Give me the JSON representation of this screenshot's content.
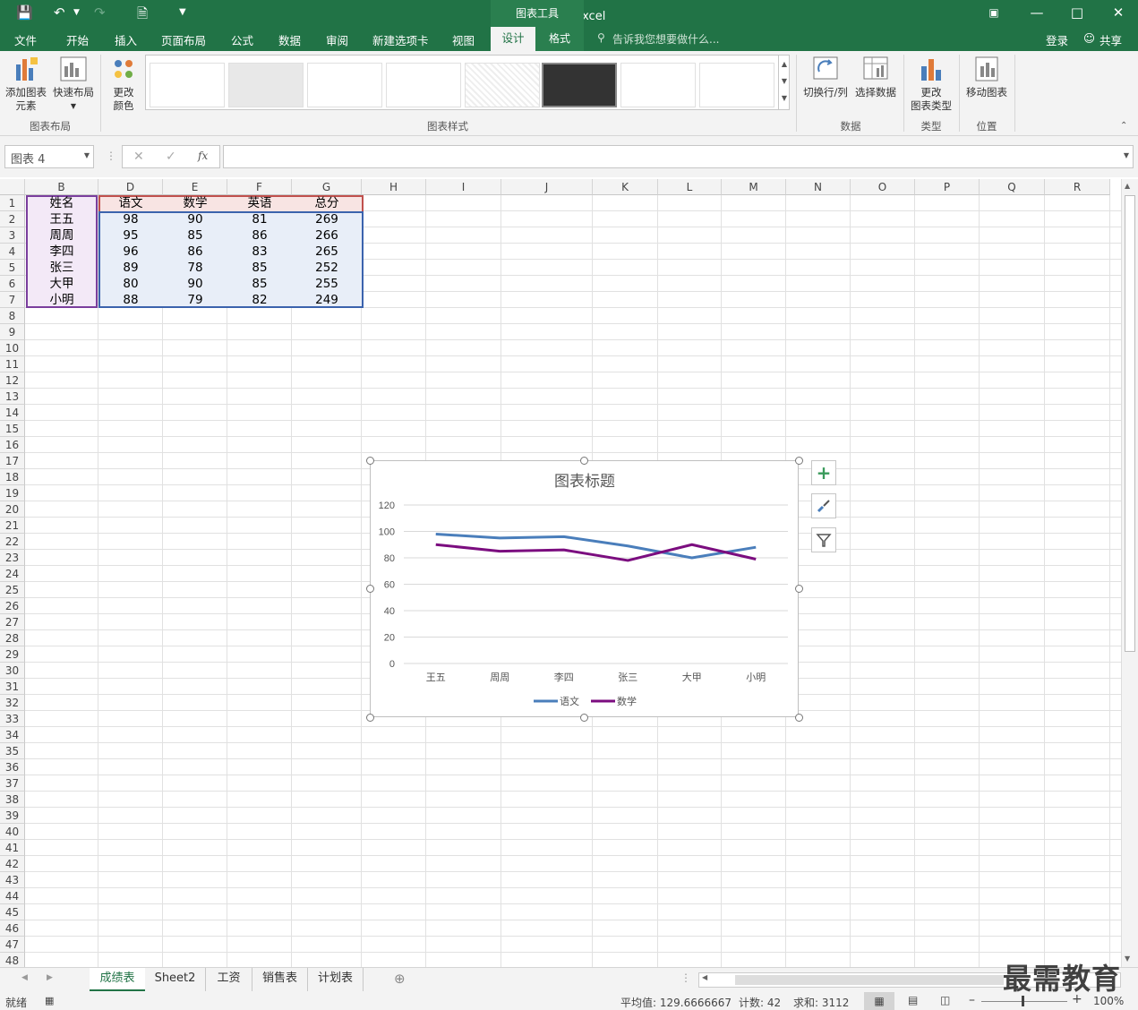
{
  "window": {
    "title": "表格1 - Excel",
    "context_tool": "图表工具"
  },
  "tabs": [
    "文件",
    "开始",
    "插入",
    "页面布局",
    "公式",
    "数据",
    "审阅",
    "新建选项卡",
    "视图"
  ],
  "active_tab": "设计",
  "format_tab": "格式",
  "tell_me": "告诉我您想要做什么...",
  "login": "登录",
  "share": "共享",
  "ribbon": {
    "add_element": "添加图表",
    "add_element2": "元素",
    "quick_layout": "快速布局",
    "change_color": "更改",
    "change_color2": "颜色",
    "group_layout": "图表布局",
    "group_styles": "图表样式",
    "switch_rowcol": "切换行/列",
    "select_data": "选择数据",
    "group_data": "数据",
    "change_type": "更改",
    "change_type2": "图表类型",
    "group_type": "类型",
    "move_chart": "移动图表",
    "group_location": "位置"
  },
  "namebox": "图表 4",
  "fx": "fx",
  "columns": [
    "B",
    "D",
    "E",
    "F",
    "G",
    "H",
    "I",
    "J",
    "K",
    "L",
    "M",
    "N",
    "O",
    "P",
    "Q",
    "R"
  ],
  "rows": [
    "1",
    "2",
    "3",
    "4",
    "5",
    "6",
    "7",
    "8",
    "9",
    "10",
    "11",
    "12",
    "13",
    "14",
    "15",
    "16",
    "17",
    "18",
    "19",
    "20",
    "21",
    "22",
    "23",
    "24",
    "25",
    "26",
    "27",
    "28",
    "29",
    "30",
    "31",
    "32",
    "33",
    "34",
    "35",
    "36",
    "37",
    "38",
    "39",
    "40",
    "41",
    "42",
    "43",
    "44",
    "45",
    "46",
    "47",
    "48"
  ],
  "table": {
    "headers": [
      "姓名",
      "语文",
      "数学",
      "英语",
      "总分"
    ],
    "rows": [
      [
        "王五",
        "98",
        "90",
        "81",
        "269"
      ],
      [
        "周周",
        "95",
        "85",
        "86",
        "266"
      ],
      [
        "李四",
        "96",
        "86",
        "83",
        "265"
      ],
      [
        "张三",
        "89",
        "78",
        "85",
        "252"
      ],
      [
        "大甲",
        "80",
        "90",
        "85",
        "255"
      ],
      [
        "小明",
        "88",
        "79",
        "82",
        "249"
      ]
    ]
  },
  "chart_data": {
    "type": "line",
    "title": "图表标题",
    "categories": [
      "王五",
      "周周",
      "李四",
      "张三",
      "大甲",
      "小明"
    ],
    "series": [
      {
        "name": "语文",
        "values": [
          98,
          95,
          96,
          89,
          80,
          88
        ],
        "color": "#4a7ebb"
      },
      {
        "name": "数学",
        "values": [
          90,
          85,
          86,
          78,
          90,
          79
        ],
        "color": "#7b0d7f"
      }
    ],
    "ylim": [
      0,
      120
    ],
    "yticks": [
      "0",
      "20",
      "40",
      "60",
      "80",
      "100",
      "120"
    ],
    "grid": true,
    "legend": "bottom"
  },
  "sheets": [
    "成绩表",
    "Sheet2",
    "工资",
    "销售表",
    "计划表"
  ],
  "active_sheet": "成绩表",
  "status": {
    "ready": "就绪",
    "average": "平均值: 129.6666667",
    "count": "计数: 42",
    "sum": "求和: 3112",
    "zoom": "100%"
  },
  "watermark": "最需教育"
}
